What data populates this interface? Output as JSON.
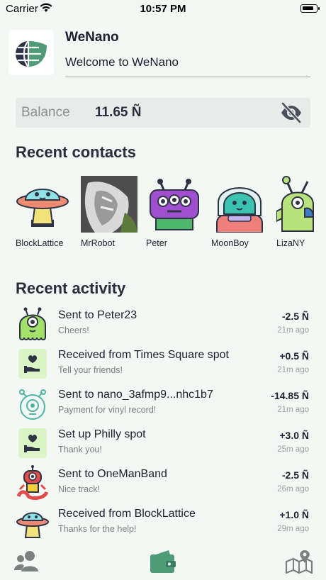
{
  "status": {
    "carrier": "Carrier",
    "time": "10:57 PM"
  },
  "header": {
    "app_name": "WeNano",
    "welcome": "Welcome to WeNano"
  },
  "balance": {
    "label": "Balance",
    "value": "11.65 Ñ",
    "visibility_icon": "eye-slash-icon"
  },
  "contacts": {
    "title": "Recent contacts",
    "items": [
      {
        "name": "BlockLattice",
        "avatar": "ufo-mushroom-avatar"
      },
      {
        "name": "MrRobot",
        "avatar": "photo-avatar"
      },
      {
        "name": "Peter",
        "avatar": "purple-alien-avatar"
      },
      {
        "name": "MoonBoy",
        "avatar": "astronaut-alien-avatar"
      },
      {
        "name": "LizaNY",
        "avatar": "green-alien-avatar"
      }
    ]
  },
  "activity": {
    "title": "Recent activity",
    "items": [
      {
        "title": "Sent to Peter23",
        "memo": "Cheers!",
        "amount": "-2.5 Ñ",
        "ago": "21m ago",
        "icon": "green-one-eyed-alien-icon"
      },
      {
        "title": "Received from Times Square spot",
        "memo": "Tell your friends!",
        "amount": "+0.5 Ñ",
        "ago": "21m ago",
        "icon": "spot-heart-icon"
      },
      {
        "title": "Sent to nano_3afmp9...nhc1b7",
        "memo": "Payment for vinyl record!",
        "amount": "-14.85 Ñ",
        "ago": "21m ago",
        "icon": "outline-alien-icon"
      },
      {
        "title": "Set up Philly spot",
        "memo": "Thank you!",
        "amount": "+3.0 Ñ",
        "ago": "25m ago",
        "icon": "spot-heart-icon"
      },
      {
        "title": "Sent to OneManBand",
        "memo": "Nice track!",
        "amount": "-2.5 Ñ",
        "ago": "26m ago",
        "icon": "red-robot-alien-icon"
      },
      {
        "title": "Received from BlockLattice",
        "memo": "Thanks for the help!",
        "amount": "+1.0 Ñ",
        "ago": "29m ago",
        "icon": "ufo-mushroom-icon"
      }
    ]
  },
  "tabs": [
    {
      "icon": "contacts-icon"
    },
    {
      "icon": "wallet-icon"
    },
    {
      "icon": "map-icon"
    }
  ],
  "colors": {
    "background": "#f3f8f5",
    "accent": "#4f9a77",
    "icon_gray": "#7b817f"
  }
}
